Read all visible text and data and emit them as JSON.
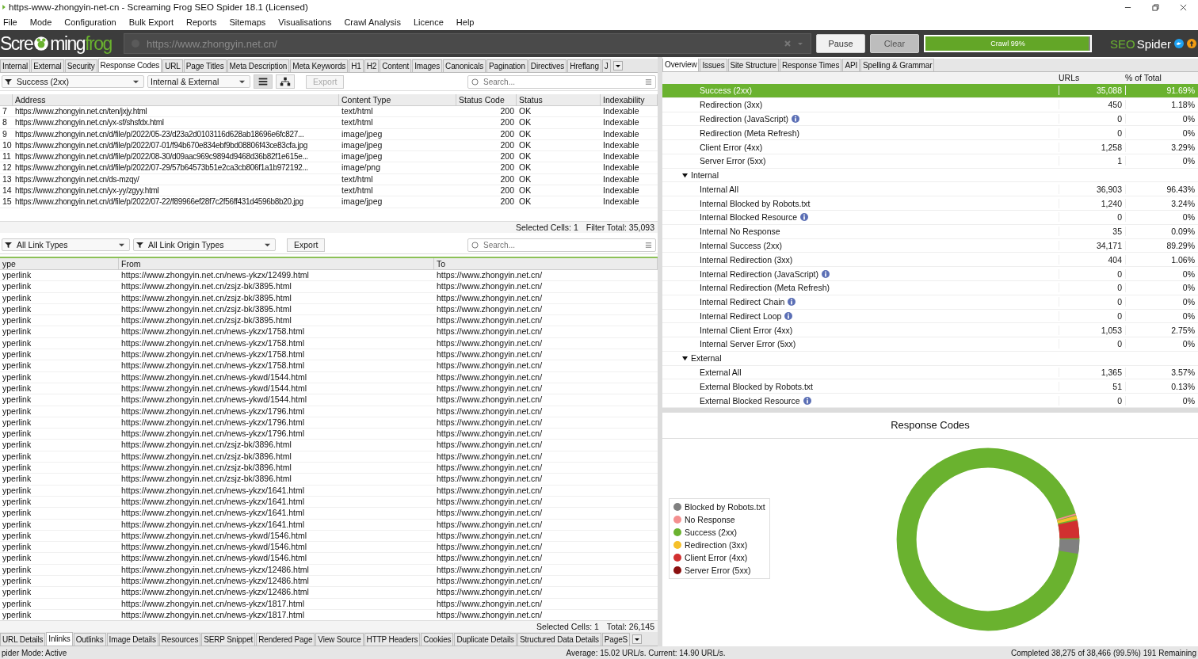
{
  "window": {
    "title": "https-www-zhongyin-net-cn - Screaming Frog SEO Spider 18.1 (Licensed)"
  },
  "menu": [
    "File",
    "Mode",
    "Configuration",
    "Bulk Export",
    "Reports",
    "Sitemaps",
    "Visualisations",
    "Crawl Analysis",
    "Licence",
    "Help"
  ],
  "toolbar": {
    "logo": {
      "text_1": "Scre",
      "text_2": "ming",
      "text_3": "frog"
    },
    "url": {
      "placeholder": "https://www.zhongyin.net.cn/"
    },
    "buttons": [
      {
        "label": "Pause",
        "disabled": false
      },
      {
        "label": "Clear",
        "disabled": true
      }
    ],
    "progress": {
      "label": "Crawl 99%",
      "level": 0.99
    },
    "brand": {
      "text_1": "SEO",
      "text_2": "Spider"
    }
  },
  "tabs": [
    {
      "label": "Internal",
      "selected": false
    },
    {
      "label": "External",
      "selected": false
    },
    {
      "label": "Security",
      "selected": false
    },
    {
      "label": "Response Codes",
      "selected": true
    },
    {
      "label": "URL",
      "selected": false
    },
    {
      "label": "Page Titles",
      "selected": false
    },
    {
      "label": "Meta Description",
      "selected": false
    },
    {
      "label": "Meta Keywords",
      "selected": false
    },
    {
      "label": "H1",
      "selected": false
    },
    {
      "label": "H2",
      "selected": false
    },
    {
      "label": "Content",
      "selected": false
    },
    {
      "label": "Images",
      "selected": false
    },
    {
      "label": "Canonicals",
      "selected": false
    },
    {
      "label": "Pagination",
      "selected": false
    },
    {
      "label": "Directives",
      "selected": false
    },
    {
      "label": "Hreflang",
      "selected": false
    },
    {
      "label": "J",
      "selected": false
    }
  ],
  "filters": {
    "status": "Success (2xx)",
    "scope": "Internal & External",
    "export": "Export",
    "search": {
      "placeholder": "Search..."
    }
  },
  "table": {
    "columns": [
      "Address",
      "Content Type",
      "Status Code",
      "Status",
      "Indexability"
    ],
    "rows": [
      {
        "n": "7",
        "cells": [
          "https://www.zhongyin.net.cn/ten/jxjy.html",
          "text/html",
          "200",
          "OK",
          "Indexable"
        ]
      },
      {
        "n": "8",
        "cells": [
          "https://www.zhongyin.net.cn/yx-sf/shsfdx.html",
          "text/html",
          "200",
          "OK",
          "Indexable"
        ]
      },
      {
        "n": "9",
        "cells": [
          "https://www.zhongyin.net.cn/d/file/p/2022/05-23/d23a2d0103116d628ab18696e6fc827...",
          "image/jpeg",
          "200",
          "OK",
          "Indexable"
        ]
      },
      {
        "n": "10",
        "cells": [
          "https://www.zhongyin.net.cn/d/file/p/2022/07-01/f94b670e834ebf9bd08806f43ce83cfa.jpg",
          "image/jpeg",
          "200",
          "OK",
          "Indexable"
        ]
      },
      {
        "n": "11",
        "cells": [
          "https://www.zhongyin.net.cn/d/file/p/2022/08-30/d09aac969c9894d9468d36b82f1e615e...",
          "image/jpeg",
          "200",
          "OK",
          "Indexable"
        ]
      },
      {
        "n": "12",
        "cells": [
          "https://www.zhongyin.net.cn/d/file/p/2022/07-29/57b64573b51e2ca3cb806f1a1b972192...",
          "image/png",
          "200",
          "OK",
          "Indexable"
        ]
      },
      {
        "n": "13",
        "cells": [
          "https://www.zhongyin.net.cn/ds-mzqy/",
          "text/html",
          "200",
          "OK",
          "Indexable"
        ]
      },
      {
        "n": "14",
        "cells": [
          "https://www.zhongyin.net.cn/yx-yy/zgyy.html",
          "text/html",
          "200",
          "OK",
          "Indexable"
        ]
      },
      {
        "n": "15",
        "cells": [
          "https://www.zhongyin.net.cn/d/file/p/2022/07-22/f89966ef28f7c2f56ff431d4596b8b20.jpg",
          "image/jpeg",
          "200",
          "OK",
          "Indexable"
        ]
      }
    ],
    "footer": {
      "label_1": "Selected Cells:",
      "value_1": "1",
      "label_2": "Filter Total:",
      "value_2": "35,093"
    }
  },
  "link_filters": {
    "type": "All Link Types",
    "origin": "All Link Origin Types",
    "export": "Export",
    "search": {
      "placeholder": "Search..."
    }
  },
  "links": {
    "columns": [
      "ype",
      "From",
      "To"
    ],
    "rows": [
      [
        "yperlink",
        "https://www.zhongyin.net.cn/news-ykzx/12499.html",
        "https://www.zhongyin.net.cn/"
      ],
      [
        "yperlink",
        "https://www.zhongyin.net.cn/zsjz-bk/3895.html",
        "https://www.zhongyin.net.cn/"
      ],
      [
        "yperlink",
        "https://www.zhongyin.net.cn/zsjz-bk/3895.html",
        "https://www.zhongyin.net.cn/"
      ],
      [
        "yperlink",
        "https://www.zhongyin.net.cn/zsjz-bk/3895.html",
        "https://www.zhongyin.net.cn/"
      ],
      [
        "yperlink",
        "https://www.zhongyin.net.cn/zsjz-bk/3895.html",
        "https://www.zhongyin.net.cn/"
      ],
      [
        "yperlink",
        "https://www.zhongyin.net.cn/news-ykzx/1758.html",
        "https://www.zhongyin.net.cn/"
      ],
      [
        "yperlink",
        "https://www.zhongyin.net.cn/news-ykzx/1758.html",
        "https://www.zhongyin.net.cn/"
      ],
      [
        "yperlink",
        "https://www.zhongyin.net.cn/news-ykzx/1758.html",
        "https://www.zhongyin.net.cn/"
      ],
      [
        "yperlink",
        "https://www.zhongyin.net.cn/news-ykzx/1758.html",
        "https://www.zhongyin.net.cn/"
      ],
      [
        "yperlink",
        "https://www.zhongyin.net.cn/news-ykwd/1544.html",
        "https://www.zhongyin.net.cn/"
      ],
      [
        "yperlink",
        "https://www.zhongyin.net.cn/news-ykwd/1544.html",
        "https://www.zhongyin.net.cn/"
      ],
      [
        "yperlink",
        "https://www.zhongyin.net.cn/news-ykwd/1544.html",
        "https://www.zhongyin.net.cn/"
      ],
      [
        "yperlink",
        "https://www.zhongyin.net.cn/news-ykzx/1796.html",
        "https://www.zhongyin.net.cn/"
      ],
      [
        "yperlink",
        "https://www.zhongyin.net.cn/news-ykzx/1796.html",
        "https://www.zhongyin.net.cn/"
      ],
      [
        "yperlink",
        "https://www.zhongyin.net.cn/news-ykzx/1796.html",
        "https://www.zhongyin.net.cn/"
      ],
      [
        "yperlink",
        "https://www.zhongyin.net.cn/zsjz-bk/3896.html",
        "https://www.zhongyin.net.cn/"
      ],
      [
        "yperlink",
        "https://www.zhongyin.net.cn/zsjz-bk/3896.html",
        "https://www.zhongyin.net.cn/"
      ],
      [
        "yperlink",
        "https://www.zhongyin.net.cn/zsjz-bk/3896.html",
        "https://www.zhongyin.net.cn/"
      ],
      [
        "yperlink",
        "https://www.zhongyin.net.cn/zsjz-bk/3896.html",
        "https://www.zhongyin.net.cn/"
      ],
      [
        "yperlink",
        "https://www.zhongyin.net.cn/news-ykzx/1641.html",
        "https://www.zhongyin.net.cn/"
      ],
      [
        "yperlink",
        "https://www.zhongyin.net.cn/news-ykzx/1641.html",
        "https://www.zhongyin.net.cn/"
      ],
      [
        "yperlink",
        "https://www.zhongyin.net.cn/news-ykzx/1641.html",
        "https://www.zhongyin.net.cn/"
      ],
      [
        "yperlink",
        "https://www.zhongyin.net.cn/news-ykzx/1641.html",
        "https://www.zhongyin.net.cn/"
      ],
      [
        "yperlink",
        "https://www.zhongyin.net.cn/news-ykwd/1546.html",
        "https://www.zhongyin.net.cn/"
      ],
      [
        "yperlink",
        "https://www.zhongyin.net.cn/news-ykwd/1546.html",
        "https://www.zhongyin.net.cn/"
      ],
      [
        "yperlink",
        "https://www.zhongyin.net.cn/news-ykwd/1546.html",
        "https://www.zhongyin.net.cn/"
      ],
      [
        "yperlink",
        "https://www.zhongyin.net.cn/news-ykzx/12486.html",
        "https://www.zhongyin.net.cn/"
      ],
      [
        "yperlink",
        "https://www.zhongyin.net.cn/news-ykzx/12486.html",
        "https://www.zhongyin.net.cn/"
      ],
      [
        "yperlink",
        "https://www.zhongyin.net.cn/news-ykzx/12486.html",
        "https://www.zhongyin.net.cn/"
      ],
      [
        "yperlink",
        "https://www.zhongyin.net.cn/news-ykzx/1817.html",
        "https://www.zhongyin.net.cn/"
      ],
      [
        "yperlink",
        "https://www.zhongyin.net.cn/news-ykzx/1817.html",
        "https://www.zhongyin.net.cn/"
      ]
    ],
    "footer": {
      "label_1": "Selected Cells:",
      "value_1": "1",
      "label_2": "Total:",
      "value_2": "26,145"
    }
  },
  "bottom_tabs": [
    {
      "label": "URL Details",
      "selected": false
    },
    {
      "label": "Inlinks",
      "selected": true
    },
    {
      "label": "Outlinks",
      "selected": false
    },
    {
      "label": "Image Details",
      "selected": false
    },
    {
      "label": "Resources",
      "selected": false
    },
    {
      "label": "SERP Snippet",
      "selected": false
    },
    {
      "label": "Rendered Page",
      "selected": false
    },
    {
      "label": "View Source",
      "selected": false
    },
    {
      "label": "HTTP Headers",
      "selected": false
    },
    {
      "label": "Cookies",
      "selected": false
    },
    {
      "label": "Duplicate Details",
      "selected": false
    },
    {
      "label": "Structured Data Details",
      "selected": false
    },
    {
      "label": "PageS",
      "selected": false
    }
  ],
  "right_tabs": [
    {
      "label": "Overview",
      "selected": true
    },
    {
      "label": "Issues",
      "selected": false
    },
    {
      "label": "Site Structure",
      "selected": false
    },
    {
      "label": "Response Times",
      "selected": false
    },
    {
      "label": "API",
      "selected": false
    },
    {
      "label": "Spelling & Grammar",
      "selected": false
    }
  ],
  "overview": {
    "columns": [
      "URLs",
      "% of Total"
    ],
    "items": [
      {
        "label": "Success (2xx)",
        "urls": "35,088",
        "pct": "91.69%",
        "selected": true,
        "info": false
      },
      {
        "label": "Redirection (3xx)",
        "urls": "450",
        "pct": "1.18%",
        "selected": false,
        "info": false
      },
      {
        "label": "Redirection (JavaScript)",
        "urls": "0",
        "pct": "0%",
        "selected": false,
        "info": true
      },
      {
        "label": "Redirection (Meta Refresh)",
        "urls": "0",
        "pct": "0%",
        "selected": false,
        "info": false
      },
      {
        "label": "Client Error (4xx)",
        "urls": "1,258",
        "pct": "3.29%",
        "selected": false,
        "info": false
      },
      {
        "label": "Server Error (5xx)",
        "urls": "1",
        "pct": "0%",
        "selected": false,
        "info": false
      },
      {
        "label": "Internal",
        "expanded": true,
        "selected": false,
        "children": [
          {
            "label": "Internal All",
            "urls": "36,903",
            "pct": "96.43%",
            "selected": false,
            "info": false
          },
          {
            "label": "Internal Blocked by Robots.txt",
            "urls": "1,240",
            "pct": "3.24%",
            "selected": false,
            "info": false
          },
          {
            "label": "Internal Blocked Resource",
            "urls": "0",
            "pct": "0%",
            "selected": false,
            "info": true
          },
          {
            "label": "Internal No Response",
            "urls": "35",
            "pct": "0.09%",
            "selected": false,
            "info": false
          },
          {
            "label": "Internal Success (2xx)",
            "urls": "34,171",
            "pct": "89.29%",
            "selected": false,
            "info": false
          },
          {
            "label": "Internal Redirection (3xx)",
            "urls": "404",
            "pct": "1.06%",
            "selected": false,
            "info": false
          },
          {
            "label": "Internal Redirection (JavaScript)",
            "urls": "0",
            "pct": "0%",
            "selected": false,
            "info": true
          },
          {
            "label": "Internal Redirection (Meta Refresh)",
            "urls": "0",
            "pct": "0%",
            "selected": false,
            "info": false
          },
          {
            "label": "Internal Redirect Chain",
            "urls": "0",
            "pct": "0%",
            "selected": false,
            "info": true
          },
          {
            "label": "Internal Redirect Loop",
            "urls": "0",
            "pct": "0%",
            "selected": false,
            "info": true
          },
          {
            "label": "Internal Client Error (4xx)",
            "urls": "1,053",
            "pct": "2.75%",
            "selected": false,
            "info": false
          },
          {
            "label": "Internal Server Error (5xx)",
            "urls": "0",
            "pct": "0%",
            "selected": false,
            "info": false
          }
        ]
      },
      {
        "label": "External",
        "expanded": true,
        "selected": false,
        "children": [
          {
            "label": "External All",
            "urls": "1,365",
            "pct": "3.57%",
            "selected": false,
            "info": false
          },
          {
            "label": "External Blocked by Robots.txt",
            "urls": "51",
            "pct": "0.13%",
            "selected": false,
            "info": false
          },
          {
            "label": "External Blocked Resource",
            "urls": "0",
            "pct": "0%",
            "selected": false,
            "info": true
          }
        ]
      }
    ]
  },
  "chart": {
    "title": "Response Codes",
    "legend": [
      {
        "label": "Blocked by Robots.txt",
        "color": "#808080"
      },
      {
        "label": "No Response",
        "color": "#f48f8f"
      },
      {
        "label": "Success (2xx)",
        "color": "#6ab22f"
      },
      {
        "label": "Redirection (3xx)",
        "color": "#f5c02a"
      },
      {
        "label": "Client Error (4xx)",
        "color": "#d13030"
      },
      {
        "label": "Server Error (5xx)",
        "color": "#8b1010"
      }
    ]
  },
  "status_bar": {
    "mode": "pider Mode: Active",
    "speed": "Average: 15.02 URL/s. Current: 14.90 URL/s.",
    "progress": "Completed 38,275 of 38,466 (99.5%) 191 Remaining"
  }
}
